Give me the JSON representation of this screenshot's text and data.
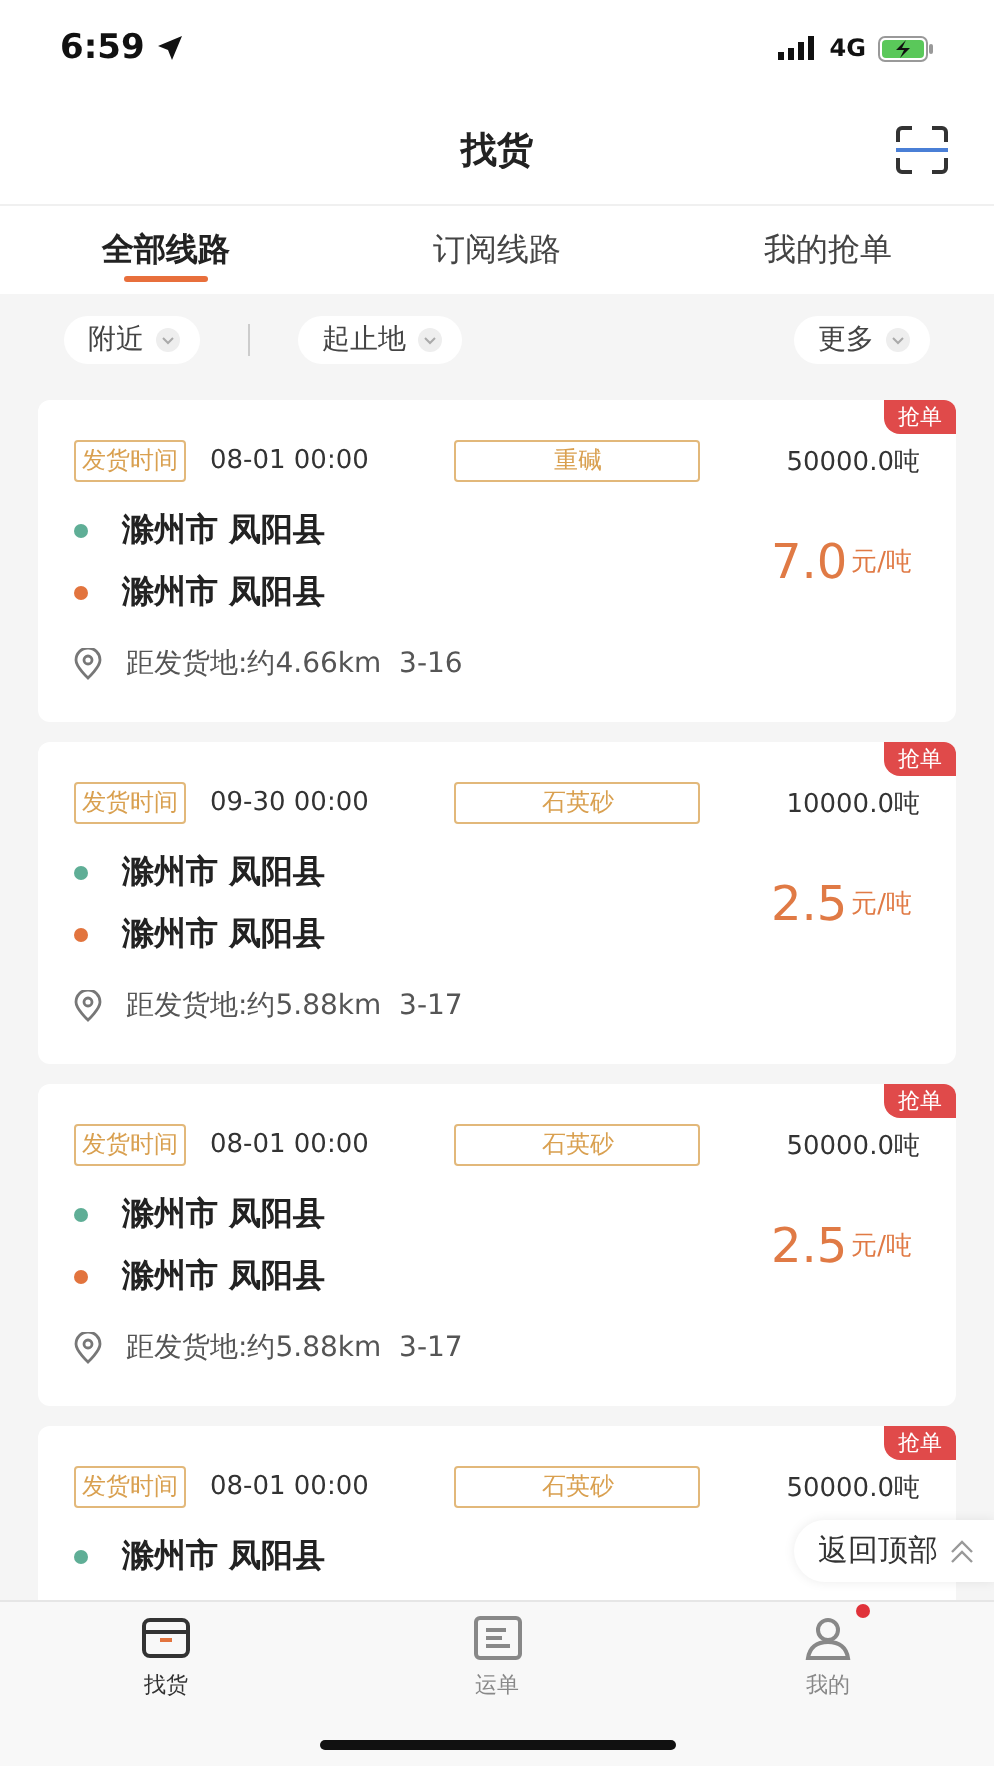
{
  "status_bar": {
    "time": "6:59",
    "network": "4G"
  },
  "header": {
    "title": "找货"
  },
  "tabs": [
    {
      "label": "全部线路",
      "selected": true
    },
    {
      "label": "订阅线路",
      "selected": false
    },
    {
      "label": "我的抢单",
      "selected": false
    }
  ],
  "filters": [
    {
      "label": "附近"
    },
    {
      "label": "起止地"
    },
    {
      "label": "更多"
    }
  ],
  "cards": [
    {
      "badge": "抢单",
      "time_tag": "发货时间",
      "time": "08-01 00:00",
      "goods": "重碱",
      "weight": "50000.0吨",
      "stops": [
        {
          "text": "滁州市 凤阳县",
          "kind": "origin"
        },
        {
          "text": "滁州市 凤阳县",
          "kind": "destination"
        }
      ],
      "price": "7.0",
      "unit": "元/吨",
      "distance": "距发货地:约4.66km  3-16"
    },
    {
      "badge": "抢单",
      "time_tag": "发货时间",
      "time": "09-30 00:00",
      "goods": "石英砂",
      "weight": "10000.0吨",
      "stops": [
        {
          "text": "滁州市 凤阳县",
          "kind": "origin"
        },
        {
          "text": "滁州市 凤阳县",
          "kind": "destination"
        }
      ],
      "price": "2.5",
      "unit": "元/吨",
      "distance": "距发货地:约5.88km  3-17"
    },
    {
      "badge": "抢单",
      "time_tag": "发货时间",
      "time": "08-01 00:00",
      "goods": "石英砂",
      "weight": "50000.0吨",
      "stops": [
        {
          "text": "滁州市 凤阳县",
          "kind": "origin"
        },
        {
          "text": "滁州市 凤阳县",
          "kind": "destination"
        }
      ],
      "price": "2.5",
      "unit": "元/吨",
      "distance": "距发货地:约5.88km  3-17"
    },
    {
      "badge": "抢单",
      "time_tag": "发货时间",
      "time": "08-01 00:00",
      "goods": "石英砂",
      "weight": "50000.0吨",
      "stops": [
        {
          "text": "滁州市 凤阳县",
          "kind": "origin"
        }
      ]
    }
  ],
  "back_to_top": {
    "label": "返回顶部"
  },
  "bottom_nav": [
    {
      "label": "找货",
      "kind": "box",
      "selected": true,
      "badge": false
    },
    {
      "label": "运单",
      "kind": "list",
      "selected": false,
      "badge": false
    },
    {
      "label": "我的",
      "kind": "user",
      "selected": false,
      "badge": true
    }
  ]
}
